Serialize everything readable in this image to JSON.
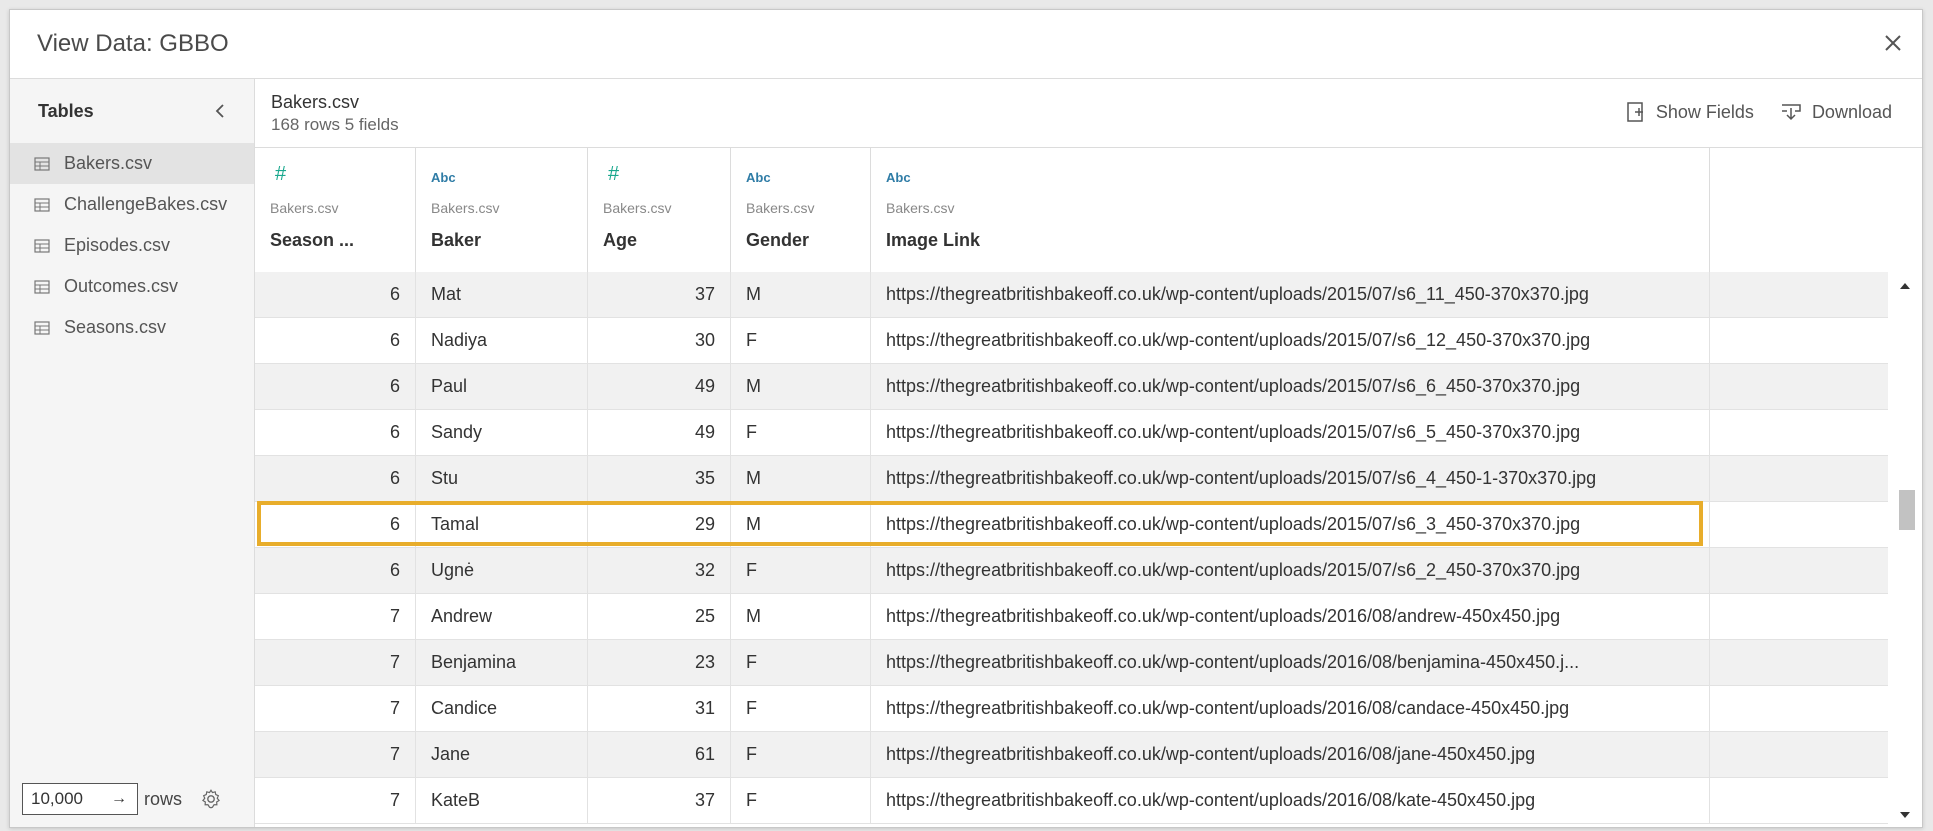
{
  "dialog": {
    "title": "View Data: GBBO"
  },
  "sidebar": {
    "title": "Tables",
    "tables": [
      {
        "label": "Bakers.csv",
        "selected": true
      },
      {
        "label": "ChallengeBakes.csv",
        "selected": false
      },
      {
        "label": "Episodes.csv",
        "selected": false
      },
      {
        "label": "Outcomes.csv",
        "selected": false
      },
      {
        "label": "Seasons.csv",
        "selected": false
      }
    ],
    "rows_value": "10,000",
    "rows_label": "rows"
  },
  "header": {
    "file_name": "Bakers.csv",
    "file_meta": "168 rows  5 fields",
    "show_fields_label": "Show Fields",
    "download_label": "Download"
  },
  "columns": [
    {
      "type": "#",
      "type_kind": "number",
      "source": "Bakers.csv",
      "name": "Season ..."
    },
    {
      "type": "Abc",
      "type_kind": "string",
      "source": "Bakers.csv",
      "name": "Baker"
    },
    {
      "type": "#",
      "type_kind": "number",
      "source": "Bakers.csv",
      "name": "Age"
    },
    {
      "type": "Abc",
      "type_kind": "string",
      "source": "Bakers.csv",
      "name": "Gender"
    },
    {
      "type": "Abc",
      "type_kind": "string",
      "source": "Bakers.csv",
      "name": "Image Link"
    }
  ],
  "rows": [
    {
      "season": "6",
      "baker": "Mat",
      "age": "37",
      "gender": "M",
      "link": "https://thegreatbritishbakeoff.co.uk/wp-content/uploads/2015/07/s6_11_450-370x370.jpg"
    },
    {
      "season": "6",
      "baker": "Nadiya",
      "age": "30",
      "gender": "F",
      "link": "https://thegreatbritishbakeoff.co.uk/wp-content/uploads/2015/07/s6_12_450-370x370.jpg"
    },
    {
      "season": "6",
      "baker": "Paul",
      "age": "49",
      "gender": "M",
      "link": "https://thegreatbritishbakeoff.co.uk/wp-content/uploads/2015/07/s6_6_450-370x370.jpg"
    },
    {
      "season": "6",
      "baker": "Sandy",
      "age": "49",
      "gender": "F",
      "link": "https://thegreatbritishbakeoff.co.uk/wp-content/uploads/2015/07/s6_5_450-370x370.jpg"
    },
    {
      "season": "6",
      "baker": "Stu",
      "age": "35",
      "gender": "M",
      "link": "https://thegreatbritishbakeoff.co.uk/wp-content/uploads/2015/07/s6_4_450-1-370x370.jpg"
    },
    {
      "season": "6",
      "baker": "Tamal",
      "age": "29",
      "gender": "M",
      "link": "https://thegreatbritishbakeoff.co.uk/wp-content/uploads/2015/07/s6_3_450-370x370.jpg",
      "highlighted": true
    },
    {
      "season": "6",
      "baker": "Ugnė",
      "age": "32",
      "gender": "F",
      "link": "https://thegreatbritishbakeoff.co.uk/wp-content/uploads/2015/07/s6_2_450-370x370.jpg"
    },
    {
      "season": "7",
      "baker": "Andrew",
      "age": "25",
      "gender": "M",
      "link": "https://thegreatbritishbakeoff.co.uk/wp-content/uploads/2016/08/andrew-450x450.jpg"
    },
    {
      "season": "7",
      "baker": "Benjamina",
      "age": "23",
      "gender": "F",
      "link": "https://thegreatbritishbakeoff.co.uk/wp-content/uploads/2016/08/benjamina-450x450.j..."
    },
    {
      "season": "7",
      "baker": "Candice",
      "age": "31",
      "gender": "F",
      "link": "https://thegreatbritishbakeoff.co.uk/wp-content/uploads/2016/08/candace-450x450.jpg"
    },
    {
      "season": "7",
      "baker": "Jane",
      "age": "61",
      "gender": "F",
      "link": "https://thegreatbritishbakeoff.co.uk/wp-content/uploads/2016/08/jane-450x450.jpg"
    },
    {
      "season": "7",
      "baker": "KateB",
      "age": "37",
      "gender": "F",
      "link": "https://thegreatbritishbakeoff.co.uk/wp-content/uploads/2016/08/kate-450x450.jpg"
    }
  ],
  "colors": {
    "highlight": "#e8ad2b",
    "number_type": "#1aa88e",
    "string_type": "#2f7ca6"
  }
}
